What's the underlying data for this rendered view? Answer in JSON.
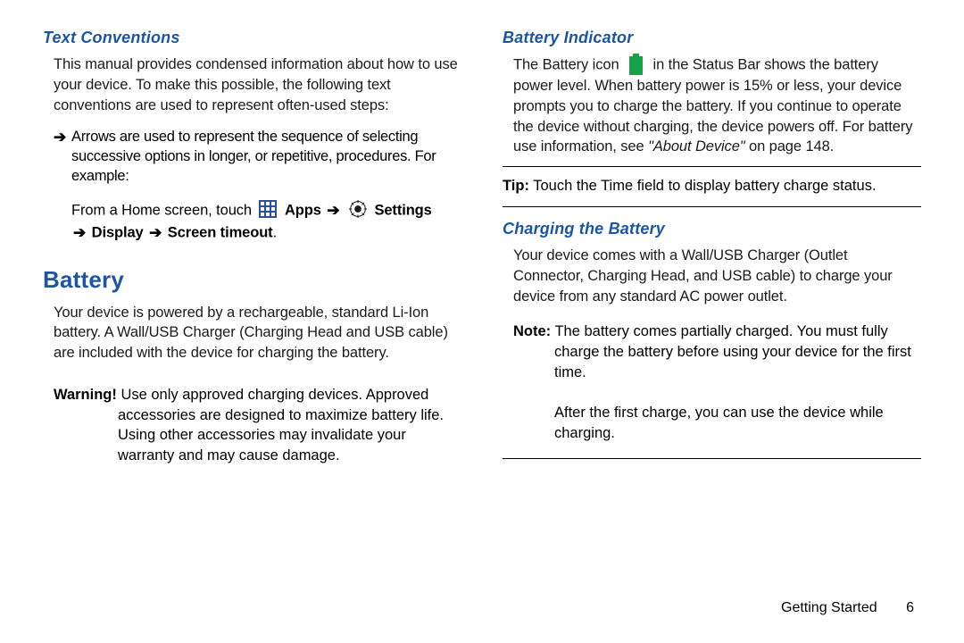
{
  "left": {
    "textConventions": {
      "heading": "Text Conventions",
      "intro": "This manual provides condensed information about how to use your device. To make this possible, the following text conventions are used to represent often-used steps:",
      "bullet_arrow": "➔",
      "bullet": "Arrows are used to represent the sequence of selecting successive options in longer, or repetitive, procedures. For example:",
      "example_pre": "From a Home screen, touch ",
      "example_apps": " Apps ",
      "arrow": "➔",
      "example_settings": " Settings ",
      "example_line2_pre": " Display ",
      "example_line2_post": " Screen timeout",
      "period": "."
    },
    "battery": {
      "heading": "Battery",
      "body": "Your device is powered by a rechargeable, standard Li-Ion battery. A Wall/USB Charger (Charging Head and USB cable) are included with the device for charging the battery.",
      "warning_label": "Warning!",
      "warning_first": " Use only approved charging devices. Approved ",
      "warning_rest": "accessories are designed to maximize battery life. Using other accessories may invalidate your warranty and may cause damage."
    }
  },
  "right": {
    "batteryIndicator": {
      "heading": "Battery Indicator",
      "pre": "The Battery icon ",
      "post": " in the Status Bar shows the battery power level. When battery power is 15% or less, your device prompts you to charge the battery. If you continue to operate the device without charging, the device powers off. For battery use information, see ",
      "ref": "\"About Device\"",
      "page_ref": " on page 148.",
      "tip_label": "Tip:",
      "tip_body": " Touch the Time field to display battery charge status."
    },
    "charging": {
      "heading": "Charging the Battery",
      "body": "Your device comes with a Wall/USB Charger (Outlet Connector, Charging Head, and USB cable) to charge your device from any standard AC power outlet.",
      "note_label": "Note:",
      "note_first": " The battery comes partially charged. You must fully ",
      "note_rest": "charge the battery before using your device for the first time.",
      "after": "After the first charge, you can use the device while charging."
    }
  },
  "footer": {
    "section": "Getting Started",
    "page": "6"
  }
}
